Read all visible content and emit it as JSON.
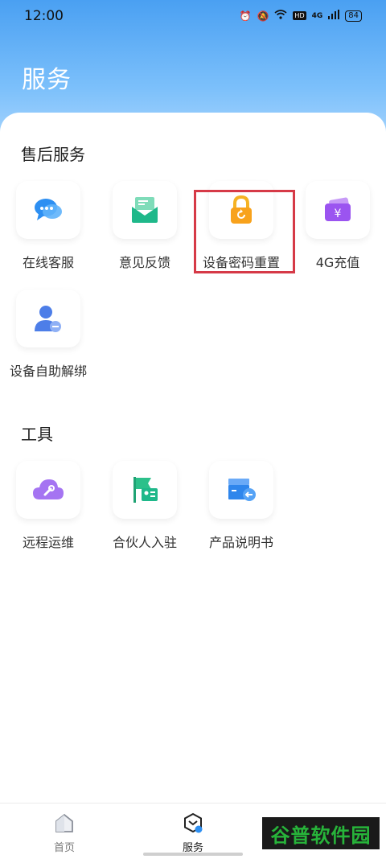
{
  "status_bar": {
    "time": "12:00",
    "network": "4G",
    "battery": "84",
    "hd": "HD"
  },
  "header": {
    "title": "服务"
  },
  "sections": [
    {
      "title": "售后服务",
      "items": [
        {
          "label": "在线客服",
          "icon": "chat-bubbles-icon"
        },
        {
          "label": "意见反馈",
          "icon": "envelope-icon"
        },
        {
          "label": "设备密码重置",
          "icon": "padlock-reset-icon"
        },
        {
          "label": "4G充值",
          "icon": "wallet-yuan-icon"
        },
        {
          "label": "设备自助解绑",
          "icon": "user-remove-icon"
        }
      ]
    },
    {
      "title": "工具",
      "items": [
        {
          "label": "远程运维",
          "icon": "cloud-wrench-icon"
        },
        {
          "label": "合伙人入驻",
          "icon": "flag-id-card-icon"
        },
        {
          "label": "产品说明书",
          "icon": "box-return-icon"
        }
      ]
    }
  ],
  "bottom_nav": [
    {
      "label": "首页",
      "icon": "home-icon",
      "active": false
    },
    {
      "label": "服务",
      "icon": "service-hexagon-icon",
      "active": true
    }
  ],
  "watermark": "谷普软件园",
  "colors": {
    "header": "#4aa0f2",
    "highlight": "#d63a47",
    "accent_green": "#27b43a"
  }
}
